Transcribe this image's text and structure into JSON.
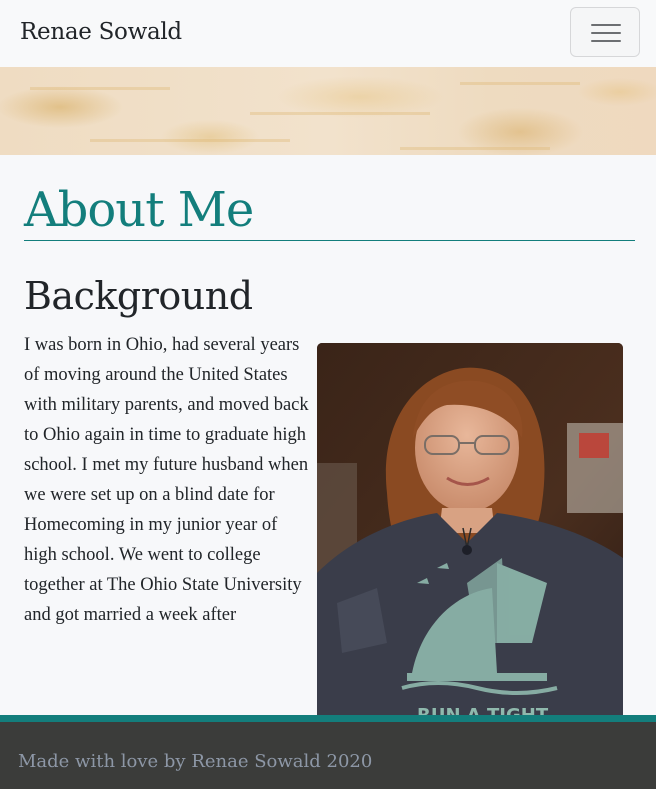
{
  "navbar": {
    "brand": "Renae Sowald",
    "toggle_icon": "hamburger-menu-icon"
  },
  "page": {
    "title": "About Me",
    "section_heading": "Background",
    "section_text": "I was born in Ohio, had several years of moving around the United States with military parents, and moved back to Ohio again in time to graduate high school. I met my future husband when we were set up on a blind date for Homecoming in my junior year of high school. We went to college together at The Ohio State University and got married a week after"
  },
  "photo": {
    "shirt_text": "RUN A TIGHT"
  },
  "footer": {
    "text": "Made with love by Renae Sowald 2020"
  },
  "colors": {
    "accent": "#137e7c",
    "footer_bg": "#3b3c3a",
    "footer_text": "#8d97a6"
  }
}
